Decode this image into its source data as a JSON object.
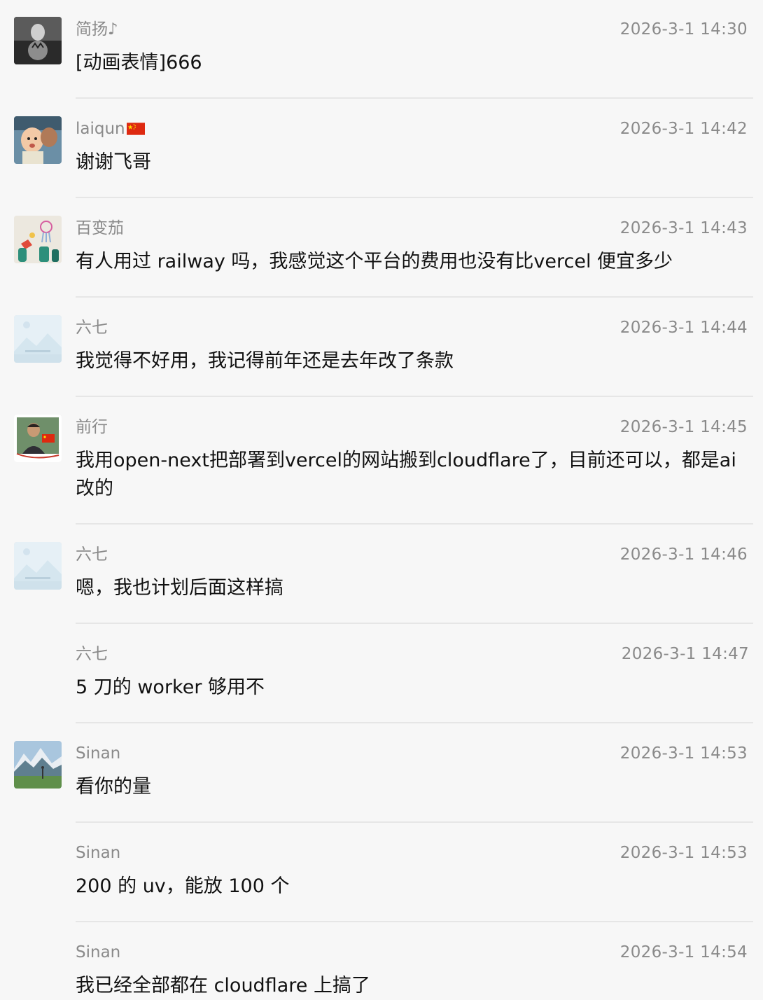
{
  "messages": [
    {
      "sender": "简扬♪",
      "time": "2026-3-1 14:30",
      "text": "[动画表情]666",
      "avatar": "tiger-reflection-avatar"
    },
    {
      "sender": "laiqun",
      "sender_flag": "cn-flag-icon",
      "time": "2026-3-1 14:42",
      "text": "谢谢飞哥",
      "avatar": "baby-photo-avatar"
    },
    {
      "sender": "百变茄",
      "time": "2026-3-1 14:43",
      "text": "有人用过 railway 吗，我感觉这个平台的费用也没有比vercel 便宜多少",
      "avatar": "drawing-avatar"
    },
    {
      "sender": "六七",
      "time": "2026-3-1 14:44",
      "text": "我觉得不好用，我记得前年还是去年改了条款",
      "avatar": "placeholder-image-avatar"
    },
    {
      "sender": "前行",
      "time": "2026-3-1 14:45",
      "text": "我用open-next把部署到vercel的网站搬到cloudflare了，目前还可以，都是ai改的",
      "avatar": "man-with-flag-avatar"
    },
    {
      "sender": "六七",
      "time": "2026-3-1 14:46",
      "text": "嗯，我也计划后面这样搞",
      "avatar": "placeholder-image-avatar"
    },
    {
      "sender": "六七",
      "time": "2026-3-1 14:47",
      "text": "5 刀的 worker 够用不",
      "avatar": ""
    },
    {
      "sender": "Sinan",
      "time": "2026-3-1 14:53",
      "text": "看你的量",
      "avatar": "mountain-landscape-avatar"
    },
    {
      "sender": "Sinan",
      "time": "2026-3-1 14:53",
      "text": "200 的 uv，能放 100 个",
      "avatar": ""
    },
    {
      "sender": "Sinan",
      "time": "2026-3-1 14:54",
      "text": "我已经全部都在 cloudflare 上搞了",
      "avatar": ""
    }
  ],
  "colors": {
    "background": "#f7f7f7",
    "meta_text": "#8a8a8a",
    "message_text": "#111111",
    "divider": "#e6e6e6",
    "flag_red": "#de2910",
    "flag_yellow": "#ffde00"
  }
}
